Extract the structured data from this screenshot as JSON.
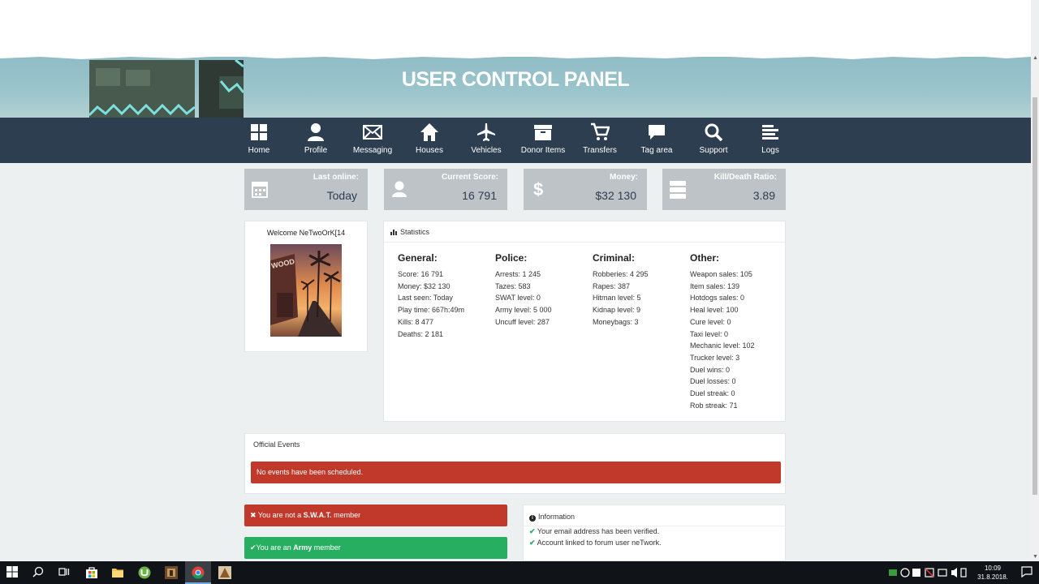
{
  "banner": {
    "title": "USER CONTROL PANEL"
  },
  "nav": [
    {
      "label": "Home",
      "icon": "home-grid-icon"
    },
    {
      "label": "Profile",
      "icon": "user-icon"
    },
    {
      "label": "Messaging",
      "icon": "envelope-icon"
    },
    {
      "label": "Houses",
      "icon": "house-icon"
    },
    {
      "label": "Vehicles",
      "icon": "plane-icon"
    },
    {
      "label": "Donor Items",
      "icon": "box-icon"
    },
    {
      "label": "Transfers",
      "icon": "cart-icon"
    },
    {
      "label": "Tag area",
      "icon": "comment-icon"
    },
    {
      "label": "Support",
      "icon": "search-icon"
    },
    {
      "label": "Logs",
      "icon": "list-icon"
    }
  ],
  "stat_boxes": [
    {
      "title": "Last online:",
      "value": "Today",
      "icon": "calendar-icon"
    },
    {
      "title": "Current Score:",
      "value": "16 791",
      "icon": "user-icon"
    },
    {
      "title": "Money:",
      "value": "$32 130",
      "icon": "dollar-icon"
    },
    {
      "title": "Kill/Death Ratio:",
      "value": "3.89",
      "icon": "server-icon"
    }
  ],
  "welcome": {
    "text": "Welcome NeTwoOrK[14"
  },
  "statistics": {
    "title": "Statistics",
    "general": {
      "heading": "General:",
      "rows": [
        "Score: 16 791",
        "Money: $32 130",
        "Last seen: Today",
        "Play time: 667h:49m",
        "Kills: 8 477",
        "Deaths: 2 181"
      ]
    },
    "police": {
      "heading": "Police:",
      "rows": [
        "Arrests: 1 245",
        "Tazes: 583",
        "SWAT level: 0",
        "Army level: 5 000",
        "Uncuff level: 287"
      ]
    },
    "criminal": {
      "heading": "Criminal:",
      "rows": [
        "Robberies: 4 295",
        "Rapes: 387",
        "Hitman level: 5",
        "Kidnap level: 9",
        "Moneybags: 3"
      ]
    },
    "other": {
      "heading": "Other:",
      "rows": [
        "Weapon sales: 105",
        "Item sales: 139",
        "Hotdogs sales: 0",
        "Heal level: 100",
        "Cure level: 0",
        "Taxi level: 0",
        "Mechanic level: 102",
        "Trucker level: 3",
        "Duel wins: 0",
        "Duel losses: 0",
        "Duel streak: 0",
        "Rob streak: 71"
      ]
    }
  },
  "events": {
    "title": "Official Events",
    "message": "No events have been scheduled."
  },
  "membership": {
    "swat_prefix": "You are not a ",
    "swat_strong": "S.W.A.T.",
    "swat_suffix": " member",
    "army_prefix": "You are an ",
    "army_strong": "Army",
    "army_suffix": " member"
  },
  "information": {
    "title": "Information",
    "rows": [
      "Your email address has been verified.",
      "Account linked to forum user neTwork."
    ]
  },
  "taskbar": {
    "time": "10:09",
    "date": "31.8.2018."
  },
  "colors": {
    "navbar": "#2c3e50",
    "stat_box": "#bdc3c7",
    "danger": "#c0392b",
    "success": "#27ae60",
    "background": "#ecf0f1"
  }
}
